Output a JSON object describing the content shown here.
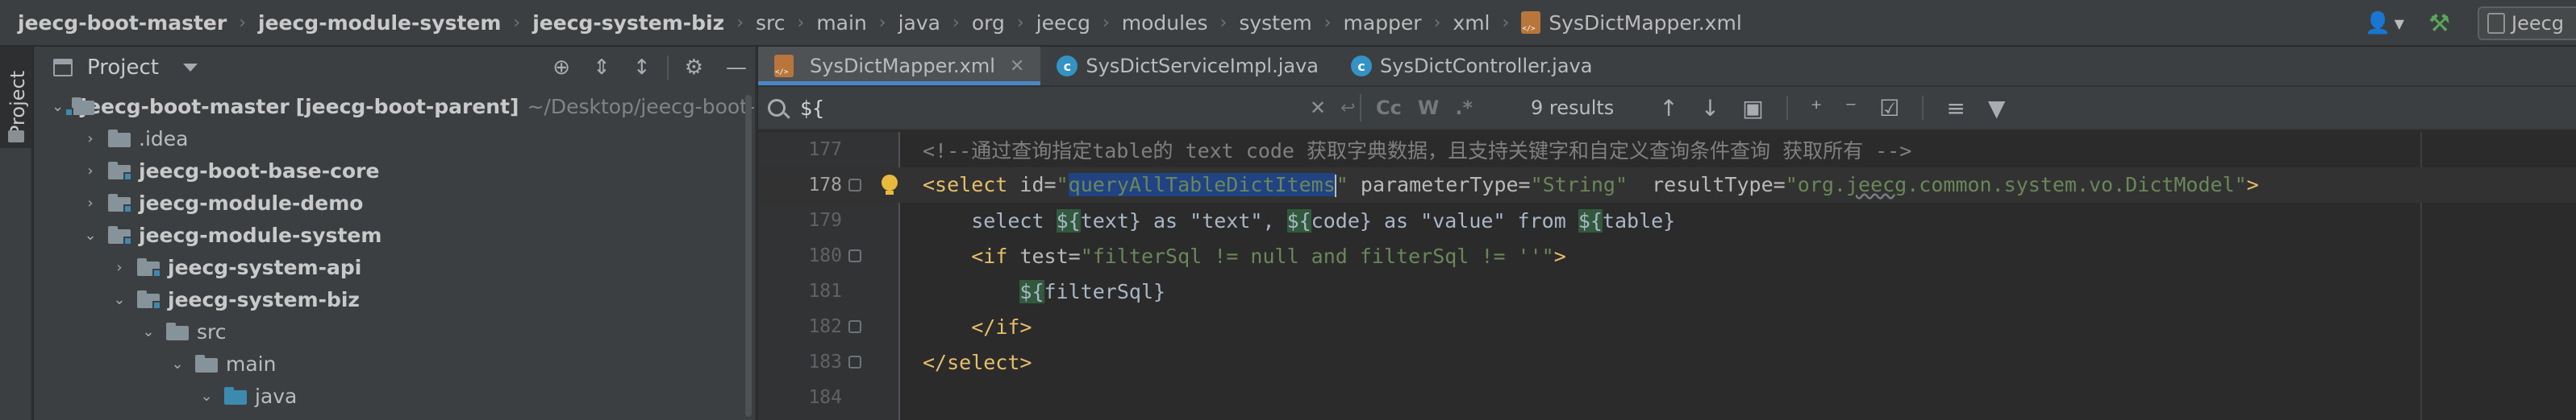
{
  "navbar": {
    "breadcrumbs": [
      {
        "label": "jeecg-boot-master",
        "bold": true
      },
      {
        "label": "jeecg-module-system",
        "bold": true
      },
      {
        "label": "jeecg-system-biz",
        "bold": true
      },
      {
        "label": "src",
        "bold": false
      },
      {
        "label": "main",
        "bold": false
      },
      {
        "label": "java",
        "bold": false
      },
      {
        "label": "org",
        "bold": false
      },
      {
        "label": "jeecg",
        "bold": false
      },
      {
        "label": "modules",
        "bold": false
      },
      {
        "label": "system",
        "bold": false
      },
      {
        "label": "mapper",
        "bold": false
      },
      {
        "label": "xml",
        "bold": false
      }
    ],
    "current_file": "SysDictMapper.xml",
    "run_config_label": "Jeecg"
  },
  "tool_strip": {
    "project_tab": "Project"
  },
  "project_panel": {
    "title": "Project",
    "tree": [
      {
        "label": "jeecg-boot-master",
        "bold_suffix": "[jeecg-boot-parent]",
        "suffix": "~/Desktop/jeecg-boot-",
        "depth": 0,
        "expanded": true,
        "bold": true,
        "folder": "module"
      },
      {
        "label": ".idea",
        "depth": 1,
        "expanded": false,
        "bold": false,
        "folder": "plain"
      },
      {
        "label": "jeecg-boot-base-core",
        "depth": 1,
        "expanded": false,
        "bold": true,
        "folder": "module"
      },
      {
        "label": "jeecg-module-demo",
        "depth": 1,
        "expanded": false,
        "bold": true,
        "folder": "module"
      },
      {
        "label": "jeecg-module-system",
        "depth": 1,
        "expanded": true,
        "bold": true,
        "folder": "module"
      },
      {
        "label": "jeecg-system-api",
        "depth": 2,
        "expanded": false,
        "bold": true,
        "folder": "module"
      },
      {
        "label": "jeecg-system-biz",
        "depth": 2,
        "expanded": true,
        "bold": true,
        "folder": "module"
      },
      {
        "label": "src",
        "depth": 3,
        "expanded": true,
        "bold": false,
        "folder": "plain"
      },
      {
        "label": "main",
        "depth": 4,
        "expanded": true,
        "bold": false,
        "folder": "plain"
      },
      {
        "label": "java",
        "depth": 5,
        "expanded": true,
        "bold": false,
        "folder": "blue"
      }
    ]
  },
  "editor": {
    "tabs": [
      {
        "label": "SysDictMapper.xml",
        "type": "xml",
        "active": true
      },
      {
        "label": "SysDictServiceImpl.java",
        "type": "java",
        "active": false
      },
      {
        "label": "SysDictController.java",
        "type": "java",
        "active": false
      }
    ],
    "search": {
      "query": "${",
      "option_labels": [
        "Cc",
        "W",
        ".*"
      ],
      "results": "9 results"
    },
    "current_line": 178,
    "lines": [
      {
        "no": "177",
        "tokens": [
          [
            "cm",
            "<!--通过查询指定table的 text code 获取字典数据，且支持关键字和自定义查询条件查询 获取所有 -->"
          ]
        ]
      },
      {
        "no": "178",
        "tokens": [
          [
            "tg",
            "<select "
          ],
          [
            "an",
            "id="
          ],
          [
            "av",
            "\""
          ],
          [
            "hl-sel",
            "queryAllTableDictItems"
          ],
          [
            "caret",
            ""
          ],
          [
            "av",
            "\" "
          ],
          [
            "an",
            "parameterType="
          ],
          [
            "av",
            "\"String\"  "
          ],
          [
            "an",
            "resultType="
          ],
          [
            "av",
            "\"org."
          ],
          [
            "avu",
            "jeecg"
          ],
          [
            "av",
            ".common.system.vo.DictModel\""
          ],
          [
            "tg",
            ">"
          ]
        ]
      },
      {
        "no": "179",
        "tokens": [
          [
            "pl",
            "    select "
          ],
          [
            "srch",
            "${"
          ],
          [
            "pl",
            "text} as \"text\", "
          ],
          [
            "srch",
            "${"
          ],
          [
            "pl",
            "code} as \"value\" from "
          ],
          [
            "srch",
            "${"
          ],
          [
            "pl",
            "table}"
          ]
        ]
      },
      {
        "no": "180",
        "tokens": [
          [
            "pl",
            "    "
          ],
          [
            "tg",
            "<if "
          ],
          [
            "an",
            "test="
          ],
          [
            "av",
            "\"filterSql != null and filterSql != ''\""
          ],
          [
            "tg",
            ">"
          ]
        ]
      },
      {
        "no": "181",
        "tokens": [
          [
            "pl",
            "        "
          ],
          [
            "srch",
            "${"
          ],
          [
            "pl",
            "filterSql}"
          ]
        ]
      },
      {
        "no": "182",
        "tokens": [
          [
            "pl",
            "    "
          ],
          [
            "tg",
            "</if>"
          ]
        ]
      },
      {
        "no": "183",
        "tokens": [
          [
            "tg",
            "</select>"
          ]
        ]
      },
      {
        "no": "184",
        "tokens": []
      }
    ]
  }
}
